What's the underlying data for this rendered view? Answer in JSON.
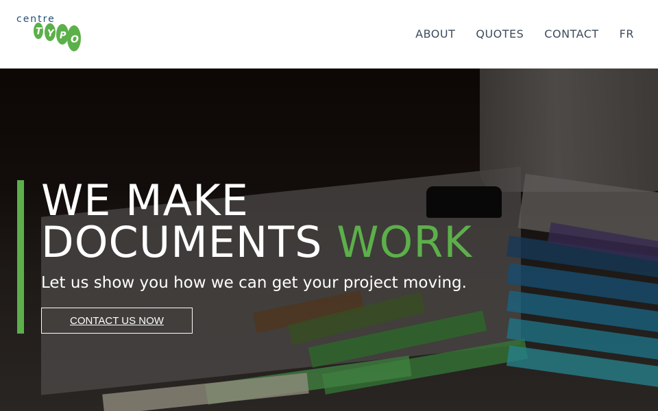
{
  "logo": {
    "top_text": "centre",
    "bottom_text": "TYPO",
    "accent_color": "#5cb04a",
    "text_color": "#1f4e79"
  },
  "nav": {
    "items": [
      "ABOUT",
      "QUOTES",
      "CONTACT",
      "FR"
    ]
  },
  "hero": {
    "headline_line1": "WE MAKE",
    "headline_line2_prefix": "DOCUMENTS",
    "headline_line2_highlight": "WORK",
    "subline": "Let us show you how we can get your project moving.",
    "cta_label": "CONTACT US NOW",
    "accent_color": "#5cb04a"
  }
}
